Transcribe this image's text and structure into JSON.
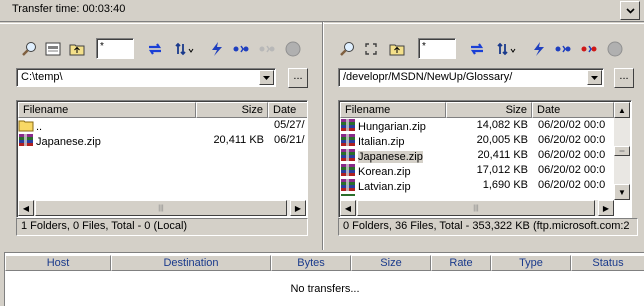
{
  "transfer_time": "Transfer time: 00:03:40",
  "left_pane": {
    "mask": "*",
    "path": "C:\\temp\\",
    "browse_label": "...",
    "columns": [
      "Filename",
      "Size",
      "Date"
    ],
    "rows": [
      {
        "name": "..",
        "size": "",
        "date": "05/27/",
        "icon": "folder-icon"
      },
      {
        "name": "Japanese.zip",
        "size": "20,411 KB",
        "date": "06/21/",
        "icon": "zip-icon"
      }
    ],
    "status": "1 Folders, 0 Files, Total - 0 (Local)"
  },
  "right_pane": {
    "mask": "*",
    "path": "/developr/MSDN/NewUp/Glossary/",
    "browse_label": "...",
    "columns": [
      "Filename",
      "Size",
      "Date"
    ],
    "rows": [
      {
        "name": "Hungarian.zip",
        "size": "14,082 KB",
        "date": "06/20/02 00:0",
        "icon": "zip-icon"
      },
      {
        "name": "Italian.zip",
        "size": "20,005 KB",
        "date": "06/20/02 00:0",
        "icon": "zip-icon"
      },
      {
        "name": "Japanese.zip",
        "size": "20,411 KB",
        "date": "06/20/02 00:0",
        "icon": "zip-icon",
        "selected": true
      },
      {
        "name": "Korean.zip",
        "size": "17,012 KB",
        "date": "06/20/02 00:0",
        "icon": "zip-icon"
      },
      {
        "name": "Latvian.zip",
        "size": "1,690 KB",
        "date": "06/20/02 00:0",
        "icon": "zip-icon"
      }
    ],
    "status": "0 Folders, 36 Files, Total - 353,322 KB  (ftp.microsoft.com:2"
  },
  "queue": {
    "columns": [
      "Host",
      "Destination",
      "Bytes",
      "Size",
      "Rate",
      "Type",
      "Status"
    ],
    "empty_text": "No transfers..."
  },
  "colors": {
    "chrome": "#d4d0c8",
    "header_text": "#1a3a8c",
    "lightning": "#1f3fbf",
    "refresh": "#1a3fd6",
    "red_dots": "#d01818"
  }
}
